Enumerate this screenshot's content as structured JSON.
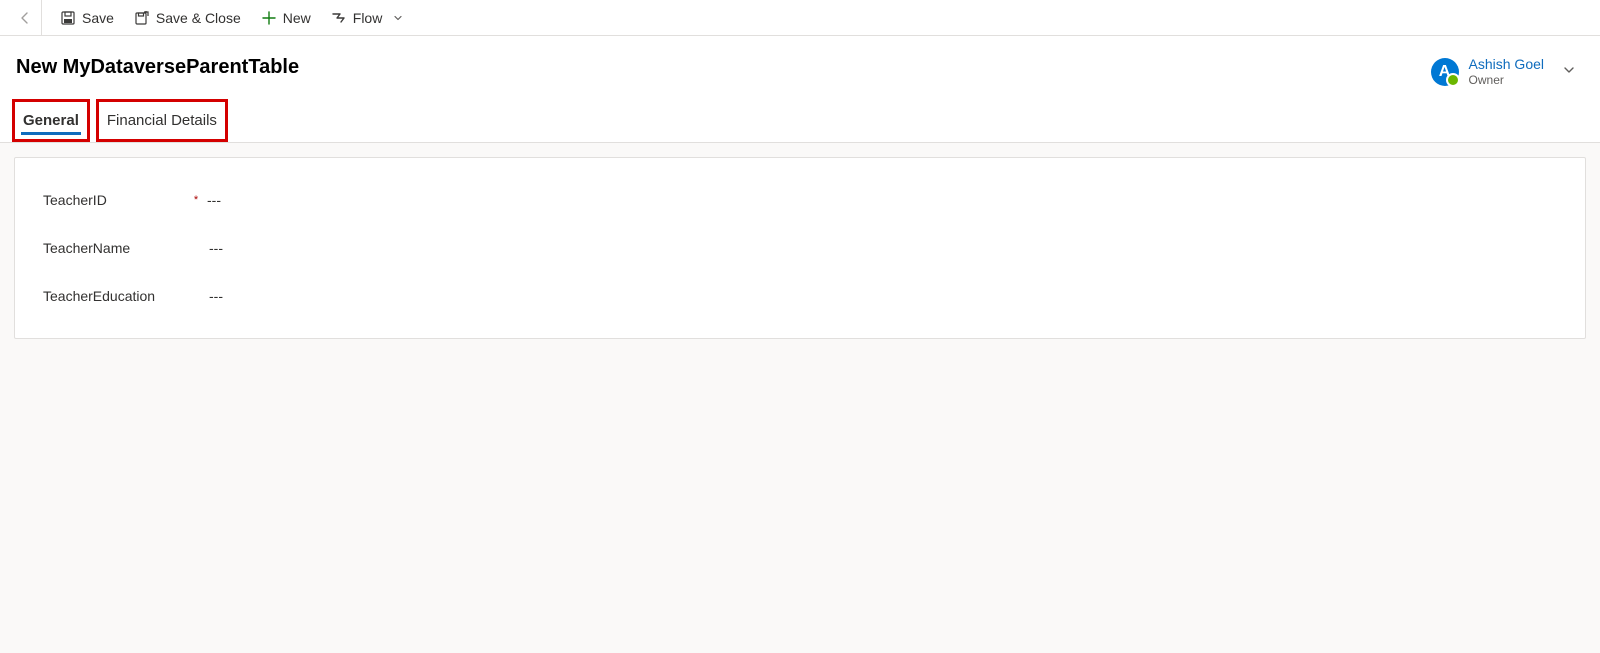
{
  "commandBar": {
    "save": "Save",
    "saveClose": "Save & Close",
    "new": "New",
    "flow": "Flow"
  },
  "pageTitle": "New MyDataverseParentTable",
  "owner": {
    "name": "Ashish Goel",
    "role": "Owner",
    "initial": "A"
  },
  "tabs": {
    "general": "General",
    "financial": "Financial Details"
  },
  "fields": {
    "teacherId": {
      "label": "TeacherID",
      "value": "---"
    },
    "teacherName": {
      "label": "TeacherName",
      "value": "---"
    },
    "teacherEducation": {
      "label": "TeacherEducation",
      "value": "---"
    }
  }
}
